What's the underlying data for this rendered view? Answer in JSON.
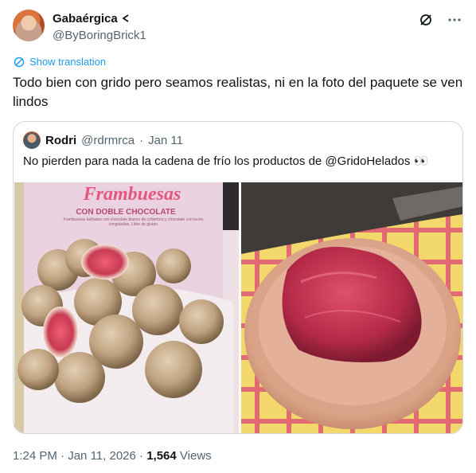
{
  "author": {
    "display_name": "Gabaérgica",
    "handle": "@ByBoringBrick1"
  },
  "icons": {
    "more": "more-icon",
    "grok": "grok-icon",
    "translate": "translate-globe-icon"
  },
  "translate_label": "Show translation",
  "tweet_text": "Todo bien con grido pero seamos realistas, ni en la foto del paquete se ven lindos",
  "quote": {
    "name": "Rodri",
    "handle": "@rdrmrca",
    "separator": "·",
    "date": "Jan 11",
    "text": "No pierden para nada la cadena de frío los productos de @GridoHelados 👀",
    "package_title": "Frambuesas",
    "package_subtitle": "CON DOBLE CHOCOLATE",
    "package_desc": "Frambuesas bañadas con chocolate blanco de cobertura y chocolate con leche, congeladas. Libre de gluten."
  },
  "footer": {
    "time": "1:24 PM",
    "sep": "·",
    "date": "Jan 11, 2026",
    "sep2": "·",
    "views_count": "1,564",
    "views_label": "Views"
  },
  "colors": {
    "accent": "#1d9bf0",
    "text": "#0f1419",
    "muted": "#536471",
    "border": "#cfd9de"
  }
}
